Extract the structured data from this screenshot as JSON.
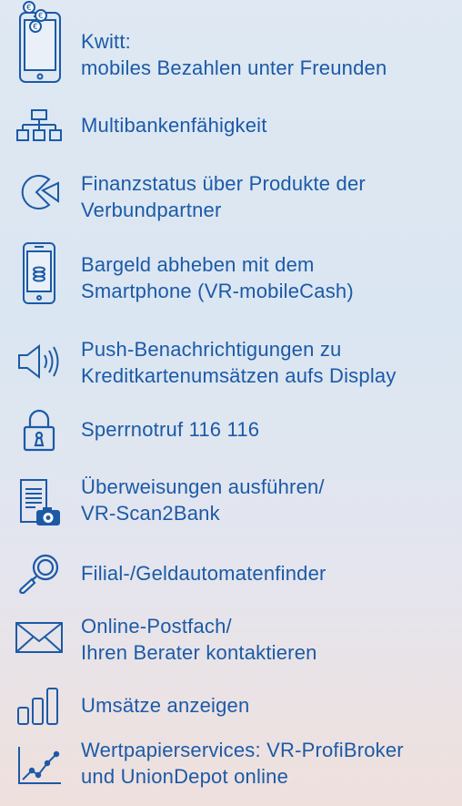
{
  "features": [
    {
      "icon": "smartphone-coins-icon",
      "lines": [
        "Kwitt:",
        "mobiles Bezahlen unter Freunden"
      ]
    },
    {
      "icon": "sitemap-icon",
      "lines": [
        "Multibankenfähigkeit"
      ]
    },
    {
      "icon": "pie-chart-icon",
      "lines": [
        "Finanzstatus über Produkte der",
        "Verbundpartner"
      ]
    },
    {
      "icon": "smartphone-cash-icon",
      "lines": [
        "Bargeld abheben mit dem",
        "Smartphone (VR-mobileCash)"
      ]
    },
    {
      "icon": "speaker-icon",
      "lines": [
        "Push-Benachrichtigungen zu",
        "Kreditkartenumsätzen aufs Display"
      ]
    },
    {
      "icon": "padlock-icon",
      "lines": [
        "Sperrnotruf 116 116"
      ]
    },
    {
      "icon": "document-camera-icon",
      "lines": [
        "Überweisungen ausführen/",
        "VR-Scan2Bank"
      ]
    },
    {
      "icon": "magnifier-icon",
      "lines": [
        "Filial-/Geldautomatenfinder"
      ]
    },
    {
      "icon": "envelope-icon",
      "lines": [
        "Online-Postfach/",
        "Ihren Berater kontaktieren"
      ]
    },
    {
      "icon": "bar-chart-icon",
      "lines": [
        "Umsätze anzeigen"
      ]
    },
    {
      "icon": "line-chart-icon",
      "lines": [
        "Wertpapierservices: VR-ProfiBroker",
        "und UnionDepot online"
      ]
    }
  ],
  "colors": {
    "accent": "#1c5aa6"
  }
}
